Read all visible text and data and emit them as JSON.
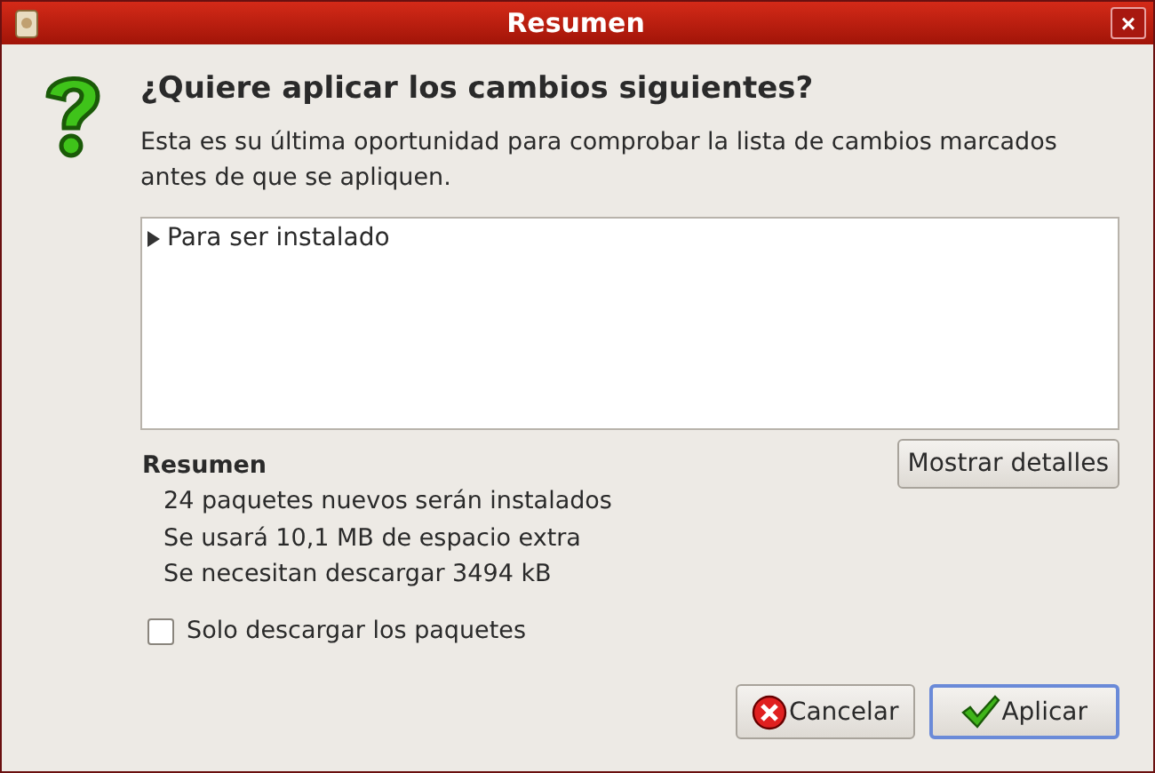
{
  "window": {
    "title": "Resumen",
    "close": "×"
  },
  "heading": "¿Quiere aplicar los cambios siguientes?",
  "message": "Esta es su última oportunidad para comprobar la lista de cambios marcados antes de que se apliquen.",
  "changes": [
    {
      "label": "Para ser instalado",
      "expanded": false
    }
  ],
  "summary": {
    "title": "Resumen",
    "lines": [
      "24 paquetes nuevos serán instalados",
      "Se usará 10,1 MB de espacio extra",
      "Se necesitan descargar 3494 kB"
    ],
    "details_button": "Mostrar detalles"
  },
  "download_only": {
    "label": "Solo descargar los paquetes",
    "checked": false
  },
  "buttons": [
    {
      "kind": "cancel",
      "label": "Cancelar",
      "focused": false
    },
    {
      "kind": "apply",
      "label": "Aplicar",
      "focused": true
    }
  ]
}
